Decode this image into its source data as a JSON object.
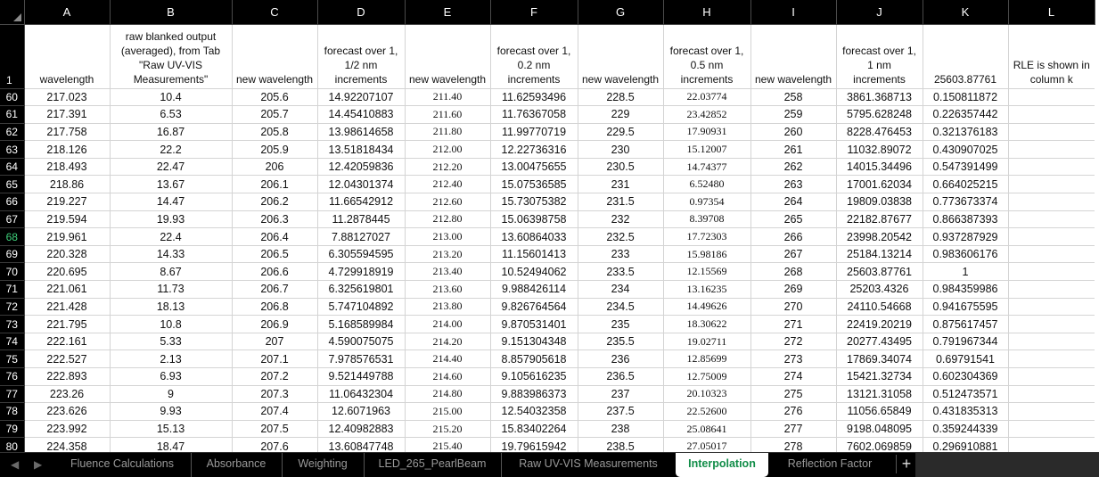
{
  "columns": [
    "A",
    "B",
    "C",
    "D",
    "E",
    "F",
    "G",
    "H",
    "I",
    "J",
    "K",
    "L"
  ],
  "header_row": {
    "number": "1",
    "labels": [
      "wavelength",
      "raw blanked output (averaged), from Tab \"Raw UV-VIS Measurements\"",
      "new wavelength",
      "forecast over 1, 1/2 nm increments",
      "new wavelength",
      "forecast over 1, 0.2 nm increments",
      "new wavelength",
      "forecast over 1, 0.5 nm increments",
      "new wavelength",
      "forecast over 1, 1  nm increments",
      "25603.87761",
      "RLE is shown in column k"
    ]
  },
  "active_row": "68",
  "rows": [
    {
      "n": "60",
      "c": [
        "217.023",
        "10.4",
        "205.6",
        "14.92207107",
        "211.40",
        "11.62593496",
        "228.5",
        "22.03774",
        "258",
        "3861.368713",
        "0.150811872",
        ""
      ]
    },
    {
      "n": "61",
      "c": [
        "217.391",
        "6.53",
        "205.7",
        "14.45410883",
        "211.60",
        "11.76367058",
        "229",
        "23.42852",
        "259",
        "5795.628248",
        "0.226357442",
        ""
      ]
    },
    {
      "n": "62",
      "c": [
        "217.758",
        "16.87",
        "205.8",
        "13.98614658",
        "211.80",
        "11.99770719",
        "229.5",
        "17.90931",
        "260",
        "8228.476453",
        "0.321376183",
        ""
      ]
    },
    {
      "n": "63",
      "c": [
        "218.126",
        "22.2",
        "205.9",
        "13.51818434",
        "212.00",
        "12.22736316",
        "230",
        "15.12007",
        "261",
        "11032.89072",
        "0.430907025",
        ""
      ]
    },
    {
      "n": "64",
      "c": [
        "218.493",
        "22.47",
        "206",
        "12.42059836",
        "212.20",
        "13.00475655",
        "230.5",
        "14.74377",
        "262",
        "14015.34496",
        "0.547391499",
        ""
      ]
    },
    {
      "n": "65",
      "c": [
        "218.86",
        "13.67",
        "206.1",
        "12.04301374",
        "212.40",
        "15.07536585",
        "231",
        "6.52480",
        "263",
        "17001.62034",
        "0.664025215",
        ""
      ]
    },
    {
      "n": "66",
      "c": [
        "219.227",
        "14.47",
        "206.2",
        "11.66542912",
        "212.60",
        "15.73075382",
        "231.5",
        "0.97354",
        "264",
        "19809.03838",
        "0.773673374",
        ""
      ]
    },
    {
      "n": "67",
      "c": [
        "219.594",
        "19.93",
        "206.3",
        "11.2878445",
        "212.80",
        "15.06398758",
        "232",
        "8.39708",
        "265",
        "22182.87677",
        "0.866387393",
        ""
      ]
    },
    {
      "n": "68",
      "c": [
        "219.961",
        "22.4",
        "206.4",
        "7.88127027",
        "213.00",
        "13.60864033",
        "232.5",
        "17.72303",
        "266",
        "23998.20542",
        "0.937287929",
        ""
      ]
    },
    {
      "n": "69",
      "c": [
        "220.328",
        "14.33",
        "206.5",
        "6.305594595",
        "213.20",
        "11.15601413",
        "233",
        "15.98186",
        "267",
        "25184.13214",
        "0.983606176",
        ""
      ]
    },
    {
      "n": "70",
      "c": [
        "220.695",
        "8.67",
        "206.6",
        "4.729918919",
        "213.40",
        "10.52494062",
        "233.5",
        "12.15569",
        "268",
        "25603.87761",
        "1",
        ""
      ]
    },
    {
      "n": "71",
      "c": [
        "221.061",
        "11.73",
        "206.7",
        "6.325619801",
        "213.60",
        "9.988426114",
        "234",
        "13.16235",
        "269",
        "25203.4326",
        "0.984359986",
        ""
      ]
    },
    {
      "n": "72",
      "c": [
        "221.428",
        "18.13",
        "206.8",
        "5.747104892",
        "213.80",
        "9.826764564",
        "234.5",
        "14.49626",
        "270",
        "24110.54668",
        "0.941675595",
        ""
      ]
    },
    {
      "n": "73",
      "c": [
        "221.795",
        "10.8",
        "206.9",
        "5.168589984",
        "214.00",
        "9.870531401",
        "235",
        "18.30622",
        "271",
        "22419.20219",
        "0.875617457",
        ""
      ]
    },
    {
      "n": "74",
      "c": [
        "222.161",
        "5.33",
        "207",
        "4.590075075",
        "214.20",
        "9.151304348",
        "235.5",
        "19.02711",
        "272",
        "20277.43495",
        "0.791967344",
        ""
      ]
    },
    {
      "n": "75",
      "c": [
        "222.527",
        "2.13",
        "207.1",
        "7.978576531",
        "214.40",
        "8.857905618",
        "236",
        "12.85699",
        "273",
        "17869.34074",
        "0.69791541",
        ""
      ]
    },
    {
      "n": "76",
      "c": [
        "222.893",
        "6.93",
        "207.2",
        "9.521449788",
        "214.60",
        "9.105616235",
        "236.5",
        "12.75009",
        "274",
        "15421.32734",
        "0.602304369",
        ""
      ]
    },
    {
      "n": "77",
      "c": [
        "223.26",
        "9",
        "207.3",
        "11.06432304",
        "214.80",
        "9.883986373",
        "237",
        "20.10323",
        "275",
        "13121.31058",
        "0.512473571",
        ""
      ]
    },
    {
      "n": "78",
      "c": [
        "223.626",
        "9.93",
        "207.4",
        "12.6071963",
        "215.00",
        "12.54032358",
        "237.5",
        "22.52600",
        "276",
        "11056.65849",
        "0.431835313",
        ""
      ]
    },
    {
      "n": "79",
      "c": [
        "223.992",
        "15.13",
        "207.5",
        "12.40982883",
        "215.20",
        "15.83402264",
        "238",
        "25.08641",
        "277",
        "9198.048095",
        "0.359244339",
        ""
      ]
    },
    {
      "n": "80",
      "c": [
        "224.358",
        "18.47",
        "207.6",
        "13.60847748",
        "215.40",
        "19.79615942",
        "238.5",
        "27.05017",
        "278",
        "7602.069859",
        "0.296910881",
        ""
      ]
    }
  ],
  "sheet_tabs": [
    {
      "label": "Fluence Calculations"
    },
    {
      "label": "Absorbance"
    },
    {
      "label": "Weighting"
    },
    {
      "label": "LED_265_PearlBeam"
    },
    {
      "label": "Raw UV-VIS Measurements"
    },
    {
      "label": "Interpolation",
      "active": true
    },
    {
      "label": "Reflection Factor"
    }
  ],
  "nav_icons": {
    "prev": "prev-sheet-icon",
    "next": "next-sheet-icon",
    "add": "plus-icon"
  },
  "add_tab_glyph": "+",
  "colors": {
    "header_bg": "#000000",
    "active_tab_text": "#118d48",
    "active_row_number": "#3ecf7a",
    "gridline": "#d4d4d4"
  }
}
